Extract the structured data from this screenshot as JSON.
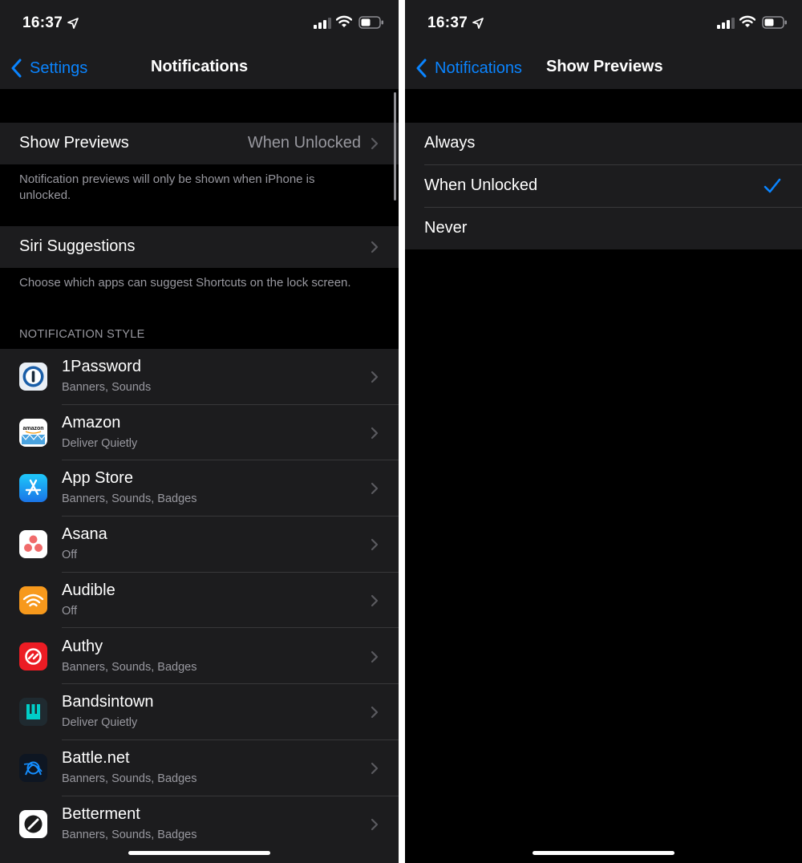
{
  "status_bar": {
    "time": "16:37"
  },
  "left_screen": {
    "back_label": "Settings",
    "title": "Notifications",
    "show_previews": {
      "label": "Show Previews",
      "value": "When Unlocked"
    },
    "show_previews_footer": "Notification previews will only be shown when iPhone is unlocked.",
    "siri_suggestions": {
      "label": "Siri Suggestions"
    },
    "siri_footer": "Choose which apps can suggest Shortcuts on the lock screen.",
    "section_header": "NOTIFICATION STYLE",
    "apps": [
      {
        "name": "1Password",
        "detail": "Banners, Sounds",
        "icon": "1password-icon"
      },
      {
        "name": "Amazon",
        "detail": "Deliver Quietly",
        "icon": "amazon-icon"
      },
      {
        "name": "App Store",
        "detail": "Banners, Sounds, Badges",
        "icon": "app-store-icon"
      },
      {
        "name": "Asana",
        "detail": "Off",
        "icon": "asana-icon"
      },
      {
        "name": "Audible",
        "detail": "Off",
        "icon": "audible-icon"
      },
      {
        "name": "Authy",
        "detail": "Banners, Sounds, Badges",
        "icon": "authy-icon"
      },
      {
        "name": "Bandsintown",
        "detail": "Deliver Quietly",
        "icon": "bandsintown-icon"
      },
      {
        "name": "Battle.net",
        "detail": "Banners, Sounds, Badges",
        "icon": "battlenet-icon"
      },
      {
        "name": "Betterment",
        "detail": "Banners, Sounds, Badges",
        "icon": "betterment-icon"
      }
    ]
  },
  "right_screen": {
    "back_label": "Notifications",
    "title": "Show Previews",
    "options": [
      {
        "label": "Always",
        "selected": false
      },
      {
        "label": "When Unlocked",
        "selected": true
      },
      {
        "label": "Never",
        "selected": false
      }
    ]
  },
  "colors": {
    "accent": "#0a84ff",
    "cell_background": "#1c1c1e",
    "page_background": "#000000",
    "secondary_text": "#98989f",
    "separator": "#38383a"
  }
}
